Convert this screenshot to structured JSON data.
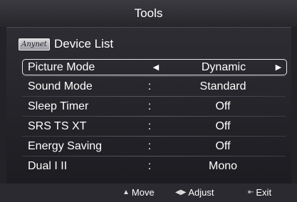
{
  "title": "Tools",
  "device_list": {
    "logo_text": "Anynet",
    "label": "Device List"
  },
  "menu": [
    {
      "label": "Picture Mode",
      "sep": "",
      "value": "Dynamic"
    },
    {
      "label": "Sound Mode",
      "sep": ":",
      "value": "Standard"
    },
    {
      "label": "Sleep Timer",
      "sep": ":",
      "value": "Off"
    },
    {
      "label": "SRS TS XT",
      "sep": ":",
      "value": "Off"
    },
    {
      "label": "Energy Saving",
      "sep": ":",
      "value": "Off"
    },
    {
      "label": "Dual I II",
      "sep": ":",
      "value": "Mono"
    }
  ],
  "selected_arrows": {
    "left": "◄",
    "right": "►"
  },
  "footer": {
    "move_icon": "updown-icon",
    "move": "Move",
    "adjust_icon": "leftright-icon",
    "adjust": "Adjust",
    "exit_icon": "exit-icon",
    "exit": "Exit"
  }
}
